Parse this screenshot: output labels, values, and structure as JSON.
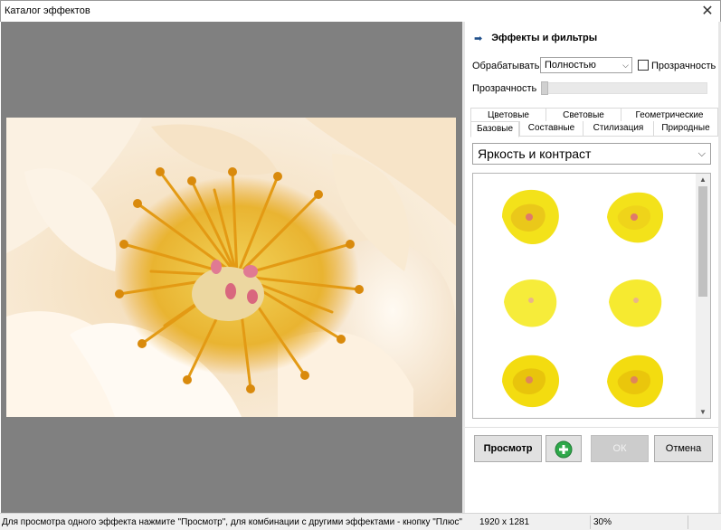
{
  "window": {
    "title": "Каталог эффектов",
    "close_glyph": "✕"
  },
  "panel": {
    "header_icon": "arrow-right-icon",
    "header": "Эффекты и фильтры",
    "process_label": "Обрабатывать",
    "process_value": "Полностью",
    "transparency_checkbox_label": "Прозрачность",
    "transparency_checked": false,
    "transparency_label": "Прозрачность",
    "transparency_level": 0,
    "tabs_back": [
      "Цветовые",
      "Световые",
      "Геометрические"
    ],
    "tabs_front": [
      "Базовые",
      "Составные",
      "Стилизация",
      "Природные"
    ],
    "active_tab": "Базовые",
    "effect_select": "Яркость и контраст"
  },
  "buttons": {
    "preview": "Просмотр",
    "plus_icon": "plus-circle-icon",
    "ok": "ОК",
    "cancel": "Отмена"
  },
  "status": {
    "hint": "Для просмотра одного эффекта нажмите \"Просмотр\", для комбинации с другими эффектами - кнопку \"Плюс\"",
    "size": "1920 x 1281",
    "zoom": "30%"
  },
  "colors": {
    "preview_bg": "#808080",
    "petal": "#f6e6cd",
    "stamen": "#e8a21b",
    "pistil": "#d9677e",
    "thumb_yellow": "#f3e21a"
  }
}
